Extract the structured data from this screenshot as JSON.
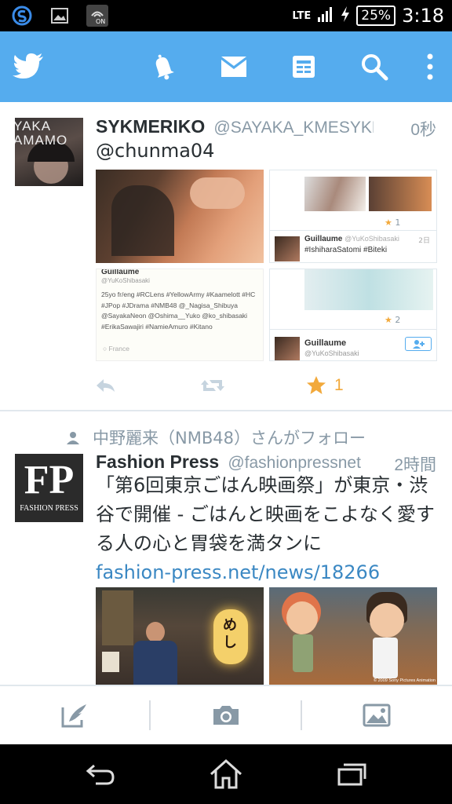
{
  "status_bar": {
    "network": "LTE",
    "battery": "25%",
    "time": "3:18"
  },
  "icons": {
    "app_logo": "twitter-bird-icon",
    "notifications": "bell-icon",
    "messages": "envelope-icon",
    "lists": "list-icon",
    "search": "search-icon",
    "menu": "overflow-menu-icon"
  },
  "colors": {
    "app_bar": "#55acee",
    "link": "#3b88c3",
    "favorite": "#f2a93b",
    "muted": "#8899a6"
  },
  "tweets": [
    {
      "display_name": "SYKMERIKO",
      "handle": "@SAYAKA_KMESYKM",
      "time": "0秒",
      "text": "@chunma04",
      "avatar_text": "YAKA AMAMO",
      "favorite_count": "1",
      "embedded": {
        "profile_name": "Guillaume",
        "profile_handle": "@YuKoShibasaki",
        "bio": "25yo fr/eng #RCLens #YellowArmy #Kaamelott #HC #JPop #JDrama #NMB48 @_Nagisa_Shibuya @SayakaNeon @Oshima__Yuko @ko_shibasaki #ErikaSawajiri #NamieAmuro #Kitano",
        "location": "France",
        "reply_text": "#IshiharaSatomi #Biteki",
        "reply_time": "2日",
        "star_count_a": "1",
        "star_count_b": "2"
      }
    },
    {
      "social_context": "中野麗来（NMB48）さんがフォロー",
      "display_name": "Fashion Press",
      "handle": "@fashionpressnet",
      "time": "2時間",
      "text": "「第6回東京ごはん映画祭」が東京・渋谷で開催 - ごはんと映画をこよなく愛する人の心と胃袋を満タンに",
      "link": "fashion-press.net/news/18266",
      "avatar_logo": "FP",
      "avatar_caption": "FASHION PRESS",
      "photo_sign": "めし",
      "photo_copyright": "© 2009 Sony Pictures Animation"
    }
  ],
  "composer": {
    "compose": "compose-icon",
    "camera": "camera-icon",
    "gallery": "image-icon"
  },
  "nav_bar": {
    "back": "back-icon",
    "home": "home-icon",
    "recents": "recents-icon"
  }
}
